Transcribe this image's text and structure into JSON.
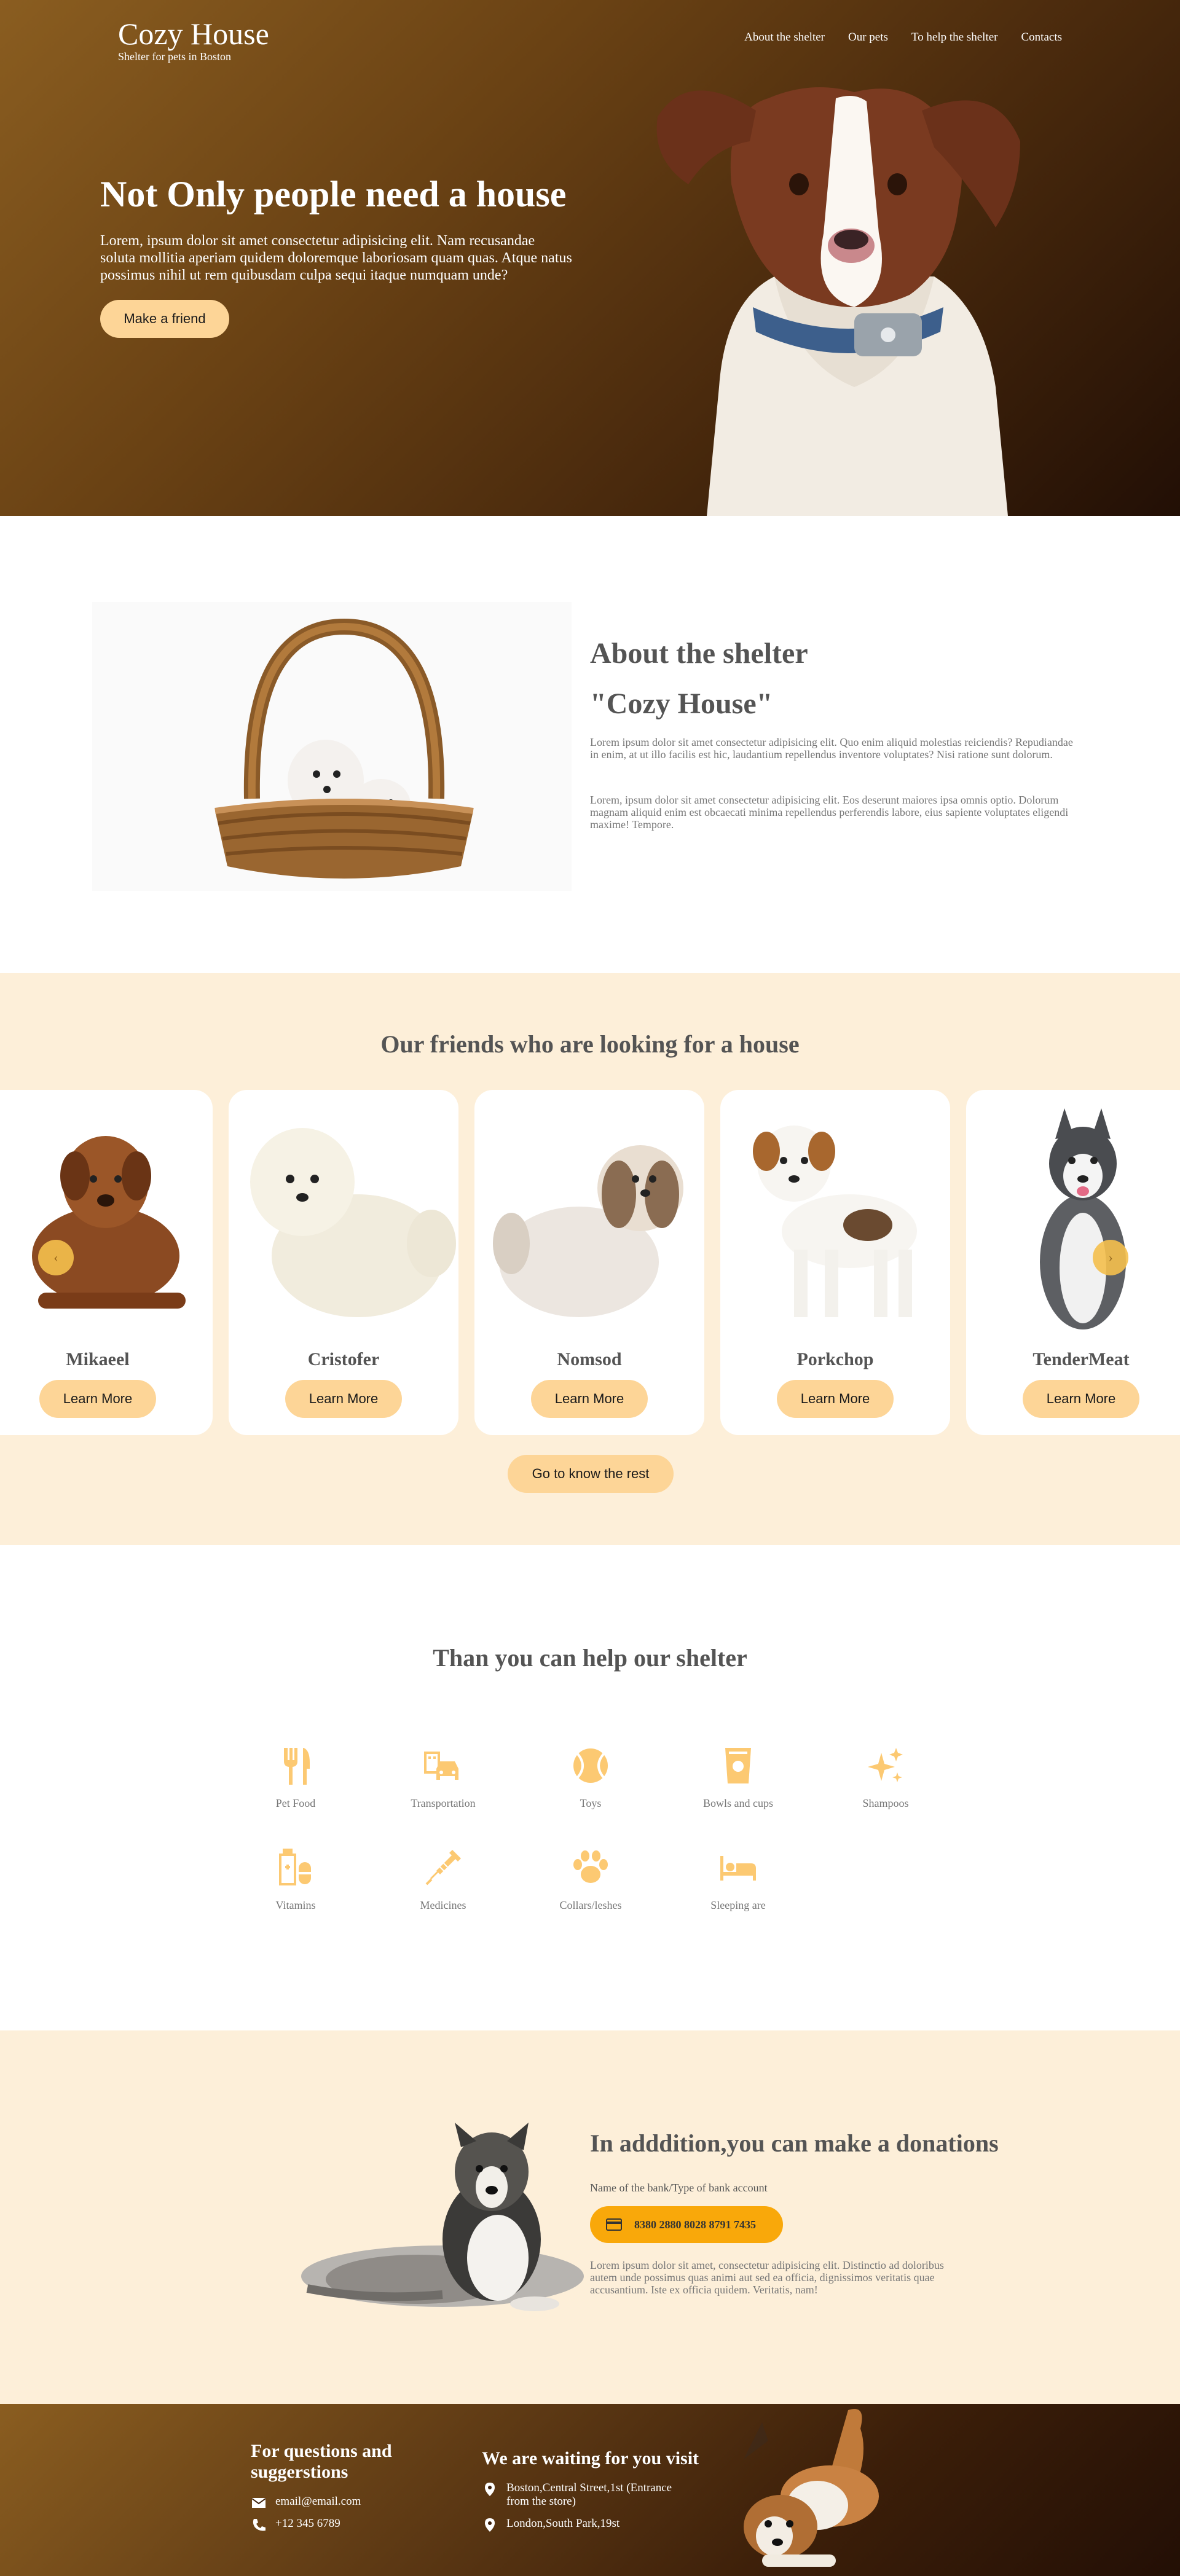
{
  "header": {
    "logo_name": "Cozy House",
    "logo_tagline": "Shelter for pets in Boston",
    "nav": [
      "About the shelter",
      "Our pets",
      "To help the shelter",
      "Contacts"
    ]
  },
  "hero": {
    "title": "Not Only people need a house",
    "text": "Lorem, ipsum dolor sit amet consectetur adipisicing elit. Nam recusandae soluta mollitia aperiam quidem doloremque laboriosam quam quas. Atque natus possimus nihil ut rem quibusdam culpa sequi itaque numquam unde?",
    "button": "Make a friend"
  },
  "about": {
    "title_line1": "About the shelter",
    "title_line2": "\"Cozy House\"",
    "para1": "Lorem ipsum dolor sit amet consectetur adipisicing elit. Quo enim aliquid molestias reiciendis? Repudiandae in enim, at ut illo facilis est hic, laudantium repellendus inventore voluptates? Nisi ratione sunt dolorum.",
    "para2": "Lorem, ipsum dolor sit amet consectetur adipisicing elit. Eos deserunt maiores ipsa omnis optio. Dolorum magnam aliquid enim est obcaecati minima repellendus perferendis labore, eius sapiente voluptates eligendi maxime! Tempore."
  },
  "pets": {
    "title": "Our friends who are looking for a house",
    "cards": [
      {
        "name": "Mikaeel",
        "button": "Learn More"
      },
      {
        "name": "Cristofer",
        "button": "Learn More"
      },
      {
        "name": "Nomsod",
        "button": "Learn More"
      },
      {
        "name": "Porkchop",
        "button": "Learn More"
      },
      {
        "name": "TenderMeat",
        "button": "Learn More"
      }
    ],
    "arrow_left": "‹",
    "arrow_right": "›",
    "rest_button": "Go to know the rest"
  },
  "help": {
    "title": "Than you can help our shelter",
    "items": [
      {
        "label": "Pet Food",
        "icon": "fork-knife-icon"
      },
      {
        "label": "Transportation",
        "icon": "transport-icon"
      },
      {
        "label": "Toys",
        "icon": "ball-icon"
      },
      {
        "label": "Bowls and cups",
        "icon": "cup-icon"
      },
      {
        "label": "Shampoos",
        "icon": "sparkle-icon"
      },
      {
        "label": "Vitamins",
        "icon": "vitamins-icon"
      },
      {
        "label": "Medicines",
        "icon": "syringe-icon"
      },
      {
        "label": "Collars/leshes",
        "icon": "paw-icon"
      },
      {
        "label": "Sleeping are",
        "icon": "bed-icon"
      }
    ],
    "icon_color": "#fcc972"
  },
  "donation": {
    "title": "In adddition,you can make a donations",
    "bank_label": "Name of the bank/Type of bank account",
    "account_number": "8380 2880 8028 8791 7435",
    "note": "Lorem ipsum dolor sit amet, consectetur adipisicing elit. Distinctio ad doloribus autem unde possimus quas animi aut sed ea officia, dignissimos veritatis quae accusantium. Iste ex officia quidem. Veritatis, nam!"
  },
  "footer": {
    "questions_title": "For questions and suggerstions",
    "email": "email@email.com",
    "phone": "+12 345 6789",
    "visit_title": "We are waiting for you visit",
    "address1": "Boston,Central Street,1st (Entrance from the store)",
    "address2": "London,South Park,19st"
  },
  "colors": {
    "accent": "#fdd597",
    "account_bg": "#f9a80a",
    "light_bg": "#fdefd9",
    "heading": "#545454"
  }
}
